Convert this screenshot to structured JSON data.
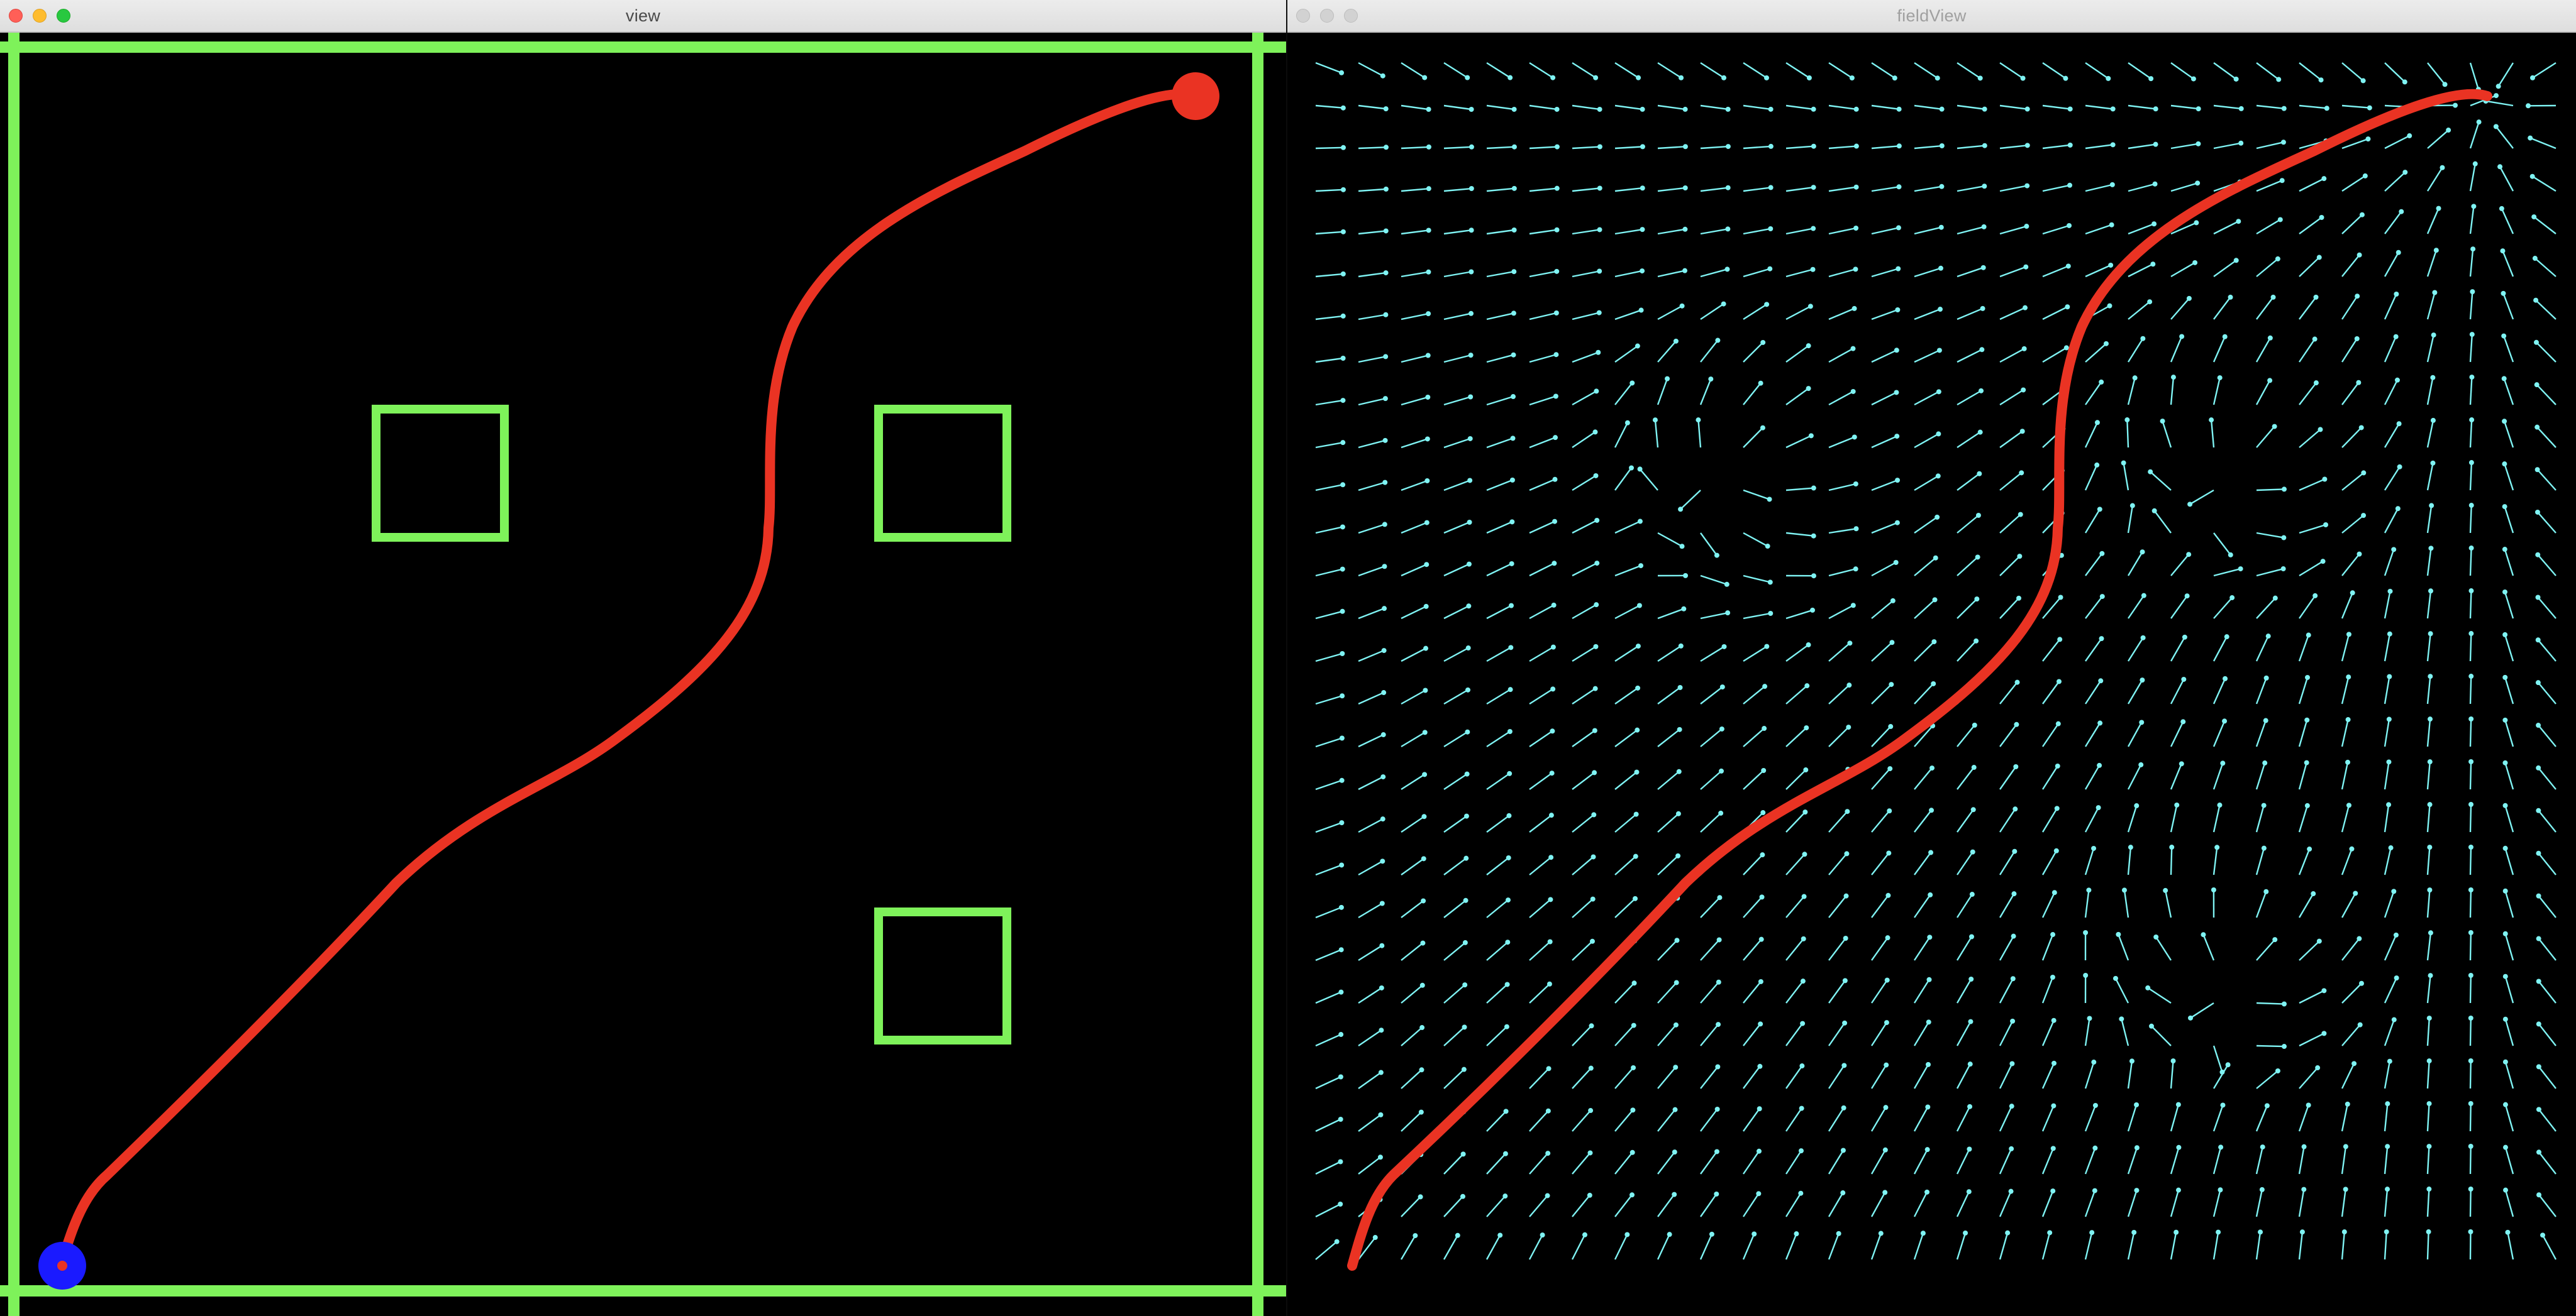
{
  "windows": {
    "view": {
      "title": "view",
      "traffic_lights": [
        "close-button",
        "minimize-button",
        "zoom-button"
      ],
      "traffic_light_colors": [
        "#ff5f57",
        "#febc2e",
        "#28c840"
      ],
      "scene": {
        "wall_color": "#7ef25a",
        "obstacle_count": 3,
        "path_color": "#ea3323",
        "start_marker_color": "#1a1aff",
        "goal_marker_color": "#ea3323"
      }
    },
    "field_view": {
      "title": "fieldView",
      "traffic_light_colors": [
        "#d2d2d2",
        "#d2d2d2",
        "#d2d2d2"
      ],
      "vector_color": "#7ff3f3",
      "path_color": "#ea3323"
    }
  }
}
